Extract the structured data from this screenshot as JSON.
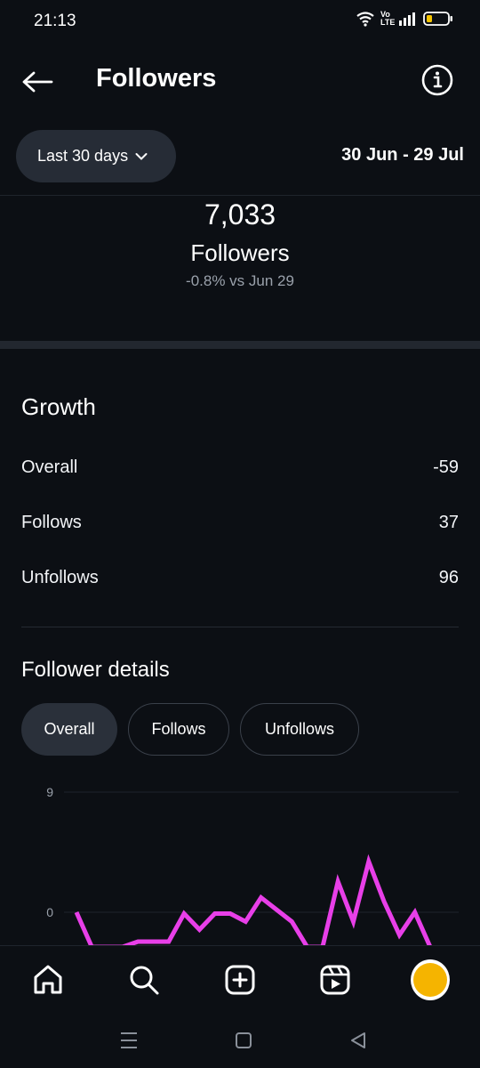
{
  "status_bar": {
    "time": "21:13",
    "network_label": "Vo LTE",
    "battery_level": 0.25
  },
  "header": {
    "title": "Followers"
  },
  "period": {
    "label": "Last 30 days",
    "range": "30 Jun - 29 Jul"
  },
  "summary": {
    "count": "7,033",
    "label": "Followers",
    "delta": "-0.8% vs Jun 29"
  },
  "growth": {
    "title": "Growth",
    "rows": [
      {
        "label": "Overall",
        "value": "-59"
      },
      {
        "label": "Follows",
        "value": "37"
      },
      {
        "label": "Unfollows",
        "value": "96"
      }
    ]
  },
  "details": {
    "title": "Follower details",
    "tabs": [
      {
        "label": "Overall",
        "selected": true
      },
      {
        "label": "Follows",
        "selected": false
      },
      {
        "label": "Unfollows",
        "selected": false
      }
    ]
  },
  "chart_data": {
    "type": "line",
    "tick_labels": [
      "9",
      "0"
    ],
    "ylim": [
      -2.6,
      9
    ],
    "series": [
      {
        "color": "#e83fe8",
        "values": [
          0,
          -2.6,
          -2.6,
          -2.6,
          -2.2,
          -2.2,
          -2.2,
          -0.1,
          -1.3,
          -0.1,
          -0.1,
          -0.7,
          1.1,
          0.2,
          -0.7,
          -2.6,
          -2.6,
          2.3,
          -0.7,
          3.8,
          0.8,
          -1.7,
          0,
          -2.6
        ]
      }
    ]
  },
  "bottom_nav": {
    "items": [
      "home-icon",
      "search-icon",
      "create-icon",
      "reels-icon",
      "profile-avatar"
    ]
  },
  "colors": {
    "background": "#0c0f14",
    "pill": "#262c36",
    "accent_line": "#e83fe8",
    "muted_text": "#9aa1ab"
  }
}
